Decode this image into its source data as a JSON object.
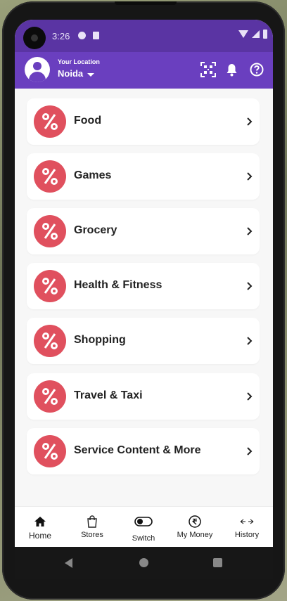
{
  "status_bar": {
    "time": "3:26"
  },
  "app_bar": {
    "location_label": "Your Location",
    "location_value": "Noida",
    "icons": [
      "qr-scan-icon",
      "bell-icon",
      "help-icon"
    ]
  },
  "categories": [
    {
      "label": "Food"
    },
    {
      "label": "Games"
    },
    {
      "label": "Grocery"
    },
    {
      "label": "Health & Fitness"
    },
    {
      "label": "Shopping"
    },
    {
      "label": "Travel & Taxi"
    },
    {
      "label": "Service Content & More"
    }
  ],
  "bottom_nav": [
    {
      "label": "Home",
      "icon": "home-icon",
      "active": true
    },
    {
      "label": "Stores",
      "icon": "shopping-bag-icon"
    },
    {
      "label": "Switch",
      "icon": "toggle-icon"
    },
    {
      "label": "My Money",
      "icon": "rupee-icon"
    },
    {
      "label": "History",
      "icon": "history-icon"
    }
  ],
  "colors": {
    "primary": "#6a3fbf",
    "status_bar": "#5a34a3",
    "badge": "#e0505e"
  }
}
